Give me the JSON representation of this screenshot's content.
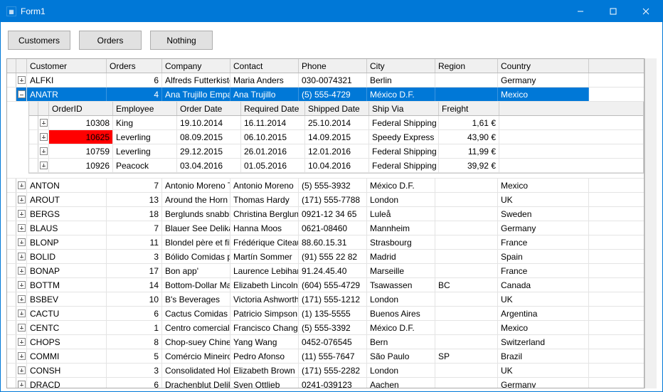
{
  "window": {
    "title": "Form1"
  },
  "toolbar": {
    "customers": "Customers",
    "orders": "Orders",
    "nothing": "Nothing"
  },
  "grid": {
    "columns": {
      "customer": "Customer",
      "orders": "Orders",
      "company": "Company",
      "contact": "Contact",
      "phone": "Phone",
      "city": "City",
      "region": "Region",
      "country": "Country"
    },
    "rows": [
      {
        "id": "ALFKI",
        "orders": "6",
        "company": "Alfreds Futterkiste",
        "contact": "Maria Anders",
        "phone": "030-0074321",
        "city": "Berlin",
        "region": "",
        "country": "Germany",
        "expanded": false
      },
      {
        "id": "ANATR",
        "orders": "4",
        "company": "Ana Trujillo Empare",
        "contact": "Ana Trujillo",
        "phone": "(5) 555-4729",
        "city": "México D.F.",
        "region": "",
        "country": "Mexico",
        "expanded": true,
        "selected": true
      },
      {
        "id": "ANTON",
        "orders": "7",
        "company": "Antonio Moreno Ta",
        "contact": "Antonio Moreno",
        "phone": "(5) 555-3932",
        "city": "México D.F.",
        "region": "",
        "country": "Mexico"
      },
      {
        "id": "AROUT",
        "orders": "13",
        "company": "Around the Horn",
        "contact": "Thomas Hardy",
        "phone": "(171) 555-7788",
        "city": "London",
        "region": "",
        "country": "UK"
      },
      {
        "id": "BERGS",
        "orders": "18",
        "company": "Berglunds snabbkö",
        "contact": "Christina Berglund",
        "phone": "0921-12 34 65",
        "city": "Luleå",
        "region": "",
        "country": "Sweden"
      },
      {
        "id": "BLAUS",
        "orders": "7",
        "company": "Blauer See Delikat",
        "contact": "Hanna Moos",
        "phone": "0621-08460",
        "city": "Mannheim",
        "region": "",
        "country": "Germany"
      },
      {
        "id": "BLONP",
        "orders": "11",
        "company": "Blondel père et fils",
        "contact": "Frédérique Citeaux",
        "phone": "88.60.15.31",
        "city": "Strasbourg",
        "region": "",
        "country": "France"
      },
      {
        "id": "BOLID",
        "orders": "3",
        "company": "Bólido Comidas pre",
        "contact": "Martín Sommer",
        "phone": "(91) 555 22 82",
        "city": "Madrid",
        "region": "",
        "country": "Spain"
      },
      {
        "id": "BONAP",
        "orders": "17",
        "company": "Bon app'",
        "contact": "Laurence Lebihan",
        "phone": "91.24.45.40",
        "city": "Marseille",
        "region": "",
        "country": "France"
      },
      {
        "id": "BOTTM",
        "orders": "14",
        "company": "Bottom-Dollar Mark",
        "contact": "Elizabeth Lincoln",
        "phone": "(604) 555-4729",
        "city": "Tsawassen",
        "region": "BC",
        "country": "Canada"
      },
      {
        "id": "BSBEV",
        "orders": "10",
        "company": "B's Beverages",
        "contact": "Victoria Ashworth",
        "phone": "(171) 555-1212",
        "city": "London",
        "region": "",
        "country": "UK"
      },
      {
        "id": "CACTU",
        "orders": "6",
        "company": "Cactus Comidas pa",
        "contact": "Patricio Simpson",
        "phone": "(1) 135-5555",
        "city": "Buenos Aires",
        "region": "",
        "country": "Argentina"
      },
      {
        "id": "CENTC",
        "orders": "1",
        "company": "Centro comercial M",
        "contact": "Francisco Chang",
        "phone": "(5) 555-3392",
        "city": "México D.F.",
        "region": "",
        "country": "Mexico"
      },
      {
        "id": "CHOPS",
        "orders": "8",
        "company": "Chop-suey Chinese",
        "contact": "Yang Wang",
        "phone": "0452-076545",
        "city": "Bern",
        "region": "",
        "country": "Switzerland"
      },
      {
        "id": "COMMI",
        "orders": "5",
        "company": "Comércio Mineiro",
        "contact": "Pedro Afonso",
        "phone": "(11) 555-7647",
        "city": "São Paulo",
        "region": "SP",
        "country": "Brazil"
      },
      {
        "id": "CONSH",
        "orders": "3",
        "company": "Consolidated Holdi",
        "contact": "Elizabeth Brown",
        "phone": "(171) 555-2282",
        "city": "London",
        "region": "",
        "country": "UK"
      },
      {
        "id": "DRACD",
        "orders": "6",
        "company": "Drachenblut Delika",
        "contact": "Sven Ottlieb",
        "phone": "0241-039123",
        "city": "Aachen",
        "region": "",
        "country": "Germany"
      }
    ],
    "child": {
      "columns": {
        "orderid": "OrderID",
        "employee": "Employee",
        "orderdate": "Order Date",
        "requireddate": "Required Date",
        "shippeddate": "Shipped Date",
        "shipvia": "Ship Via",
        "freight": "Freight"
      },
      "rows": [
        {
          "orderid": "10308",
          "employee": "King",
          "orderdate": "19.10.2014",
          "requireddate": "16.11.2014",
          "shippeddate": "25.10.2014",
          "shipvia": "Federal Shipping",
          "freight": "1,61 €",
          "red": false
        },
        {
          "orderid": "10625",
          "employee": "Leverling",
          "orderdate": "08.09.2015",
          "requireddate": "06.10.2015",
          "shippeddate": "14.09.2015",
          "shipvia": "Speedy Express",
          "freight": "43,90 €",
          "red": true
        },
        {
          "orderid": "10759",
          "employee": "Leverling",
          "orderdate": "29.12.2015",
          "requireddate": "26.01.2016",
          "shippeddate": "12.01.2016",
          "shipvia": "Federal Shipping",
          "freight": "11,99 €",
          "red": false
        },
        {
          "orderid": "10926",
          "employee": "Peacock",
          "orderdate": "03.04.2016",
          "requireddate": "01.05.2016",
          "shippeddate": "10.04.2016",
          "shipvia": "Federal Shipping",
          "freight": "39,92 €",
          "red": false
        }
      ]
    }
  }
}
